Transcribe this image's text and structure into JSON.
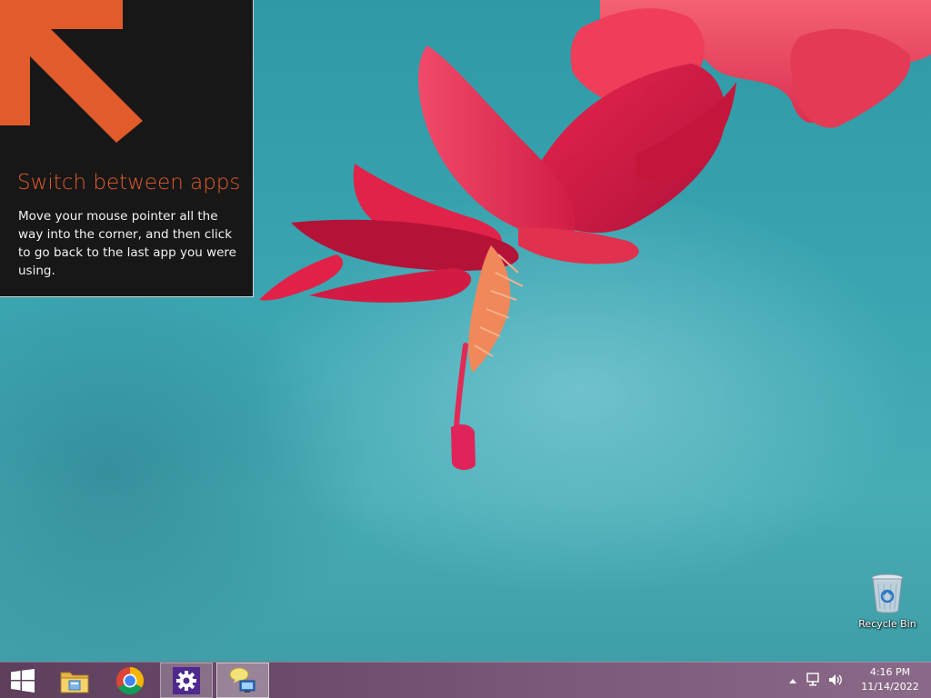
{
  "tip": {
    "title": "Switch between apps",
    "body": "Move your mouse pointer all the way into the corner, and then click to go back to the last app you were using.",
    "accent_color": "#e25b2b",
    "arrow_icon": "arrow-up-left-icon"
  },
  "desktop": {
    "icons": [
      {
        "label": "Recycle Bin",
        "icon": "recycle-bin-icon"
      }
    ]
  },
  "taskbar": {
    "buttons": [
      {
        "icon": "windows-start-icon",
        "active": false
      },
      {
        "icon": "file-explorer-icon",
        "active": false
      },
      {
        "icon": "chrome-icon",
        "active": false
      },
      {
        "icon": "settings-gear-icon",
        "active": true
      },
      {
        "icon": "network-app-icon",
        "active": true
      }
    ],
    "tray": {
      "icons": [
        "chevron-up-icon",
        "network-icon",
        "volume-icon"
      ],
      "time": "4:16 PM",
      "date": "11/14/2022"
    }
  }
}
